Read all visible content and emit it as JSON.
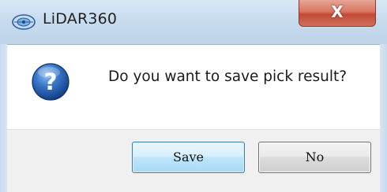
{
  "window": {
    "title": "LiDAR360",
    "logo_icon": "lidar360-logo-icon",
    "close_label": "X"
  },
  "dialog": {
    "icon": "question-icon",
    "message": "Do you want to save pick result?"
  },
  "buttons": {
    "save_label": "Save",
    "no_label": "No"
  },
  "colors": {
    "titlebar": "#c8dbee",
    "close_button": "#d0705c",
    "question_icon": "#1f56a8",
    "default_button_border": "#3c7fb1",
    "footer": "#f0f0f0"
  }
}
